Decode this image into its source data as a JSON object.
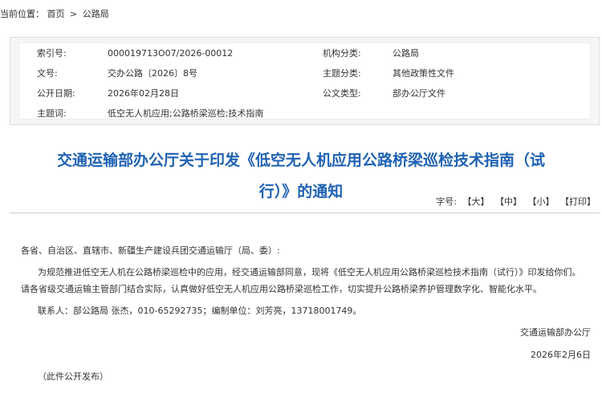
{
  "breadcrumb": {
    "label": "当前位置：",
    "home": "首页",
    "separator": ">",
    "current": "公路局"
  },
  "meta": {
    "index_label": "索引号:",
    "index_value": "000019713O07/2026-00012",
    "org_label": "机构分类:",
    "org_value": "公路局",
    "docno_label": "文号:",
    "docno_value": "交办公路〔2026〕8号",
    "topic_label": "主题分类:",
    "topic_value": "其他政策性文件",
    "date_label": "公开日期:",
    "date_value": "2026年02月28日",
    "type_label": "公文类型:",
    "type_value": "部办公厅文件",
    "keywords_label": "主题词:",
    "keywords_value": "低空无人机应用;公路桥梁巡检;技术指南"
  },
  "title": {
    "line1": "交通运输部办公厅关于印发《低空无人机应用公路桥梁巡检技术指南（试",
    "line2": "行）》的通知"
  },
  "fontsize": {
    "label": "字号:",
    "large": "【大】",
    "medium": "【中】",
    "small": "【小】",
    "print": "【打印】"
  },
  "body": {
    "salutation": "各省、自治区、直辖市、新疆生产建设兵团交通运输厅（局、委）:",
    "para1_line1": "为规范推进低空无人机在公路桥梁巡检中的应用，经交通运输部同意，现将《低空无人机应用公路桥梁巡检技术指南（试行）》印发给你们。",
    "para1_line2": "请各省级交通运输主管部门结合实际，认真做好低空无人机应用公路桥梁巡检工作，切实提升公路桥梁养护管理数字化、智能化水平。",
    "contact": "联系人：部公路局 张杰，010-65292735；编制单位：刘芳亮，13718001749。",
    "issuer": "交通运输部办公厅",
    "date": "2026年2月6日",
    "note": "（此件公开发布）"
  }
}
